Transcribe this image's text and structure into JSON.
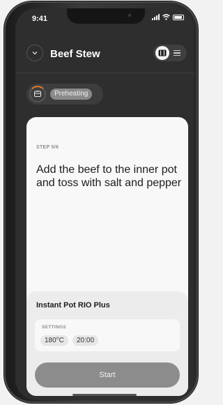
{
  "status_bar": {
    "time": "9:41"
  },
  "header": {
    "title": "Beef Stew",
    "back_icon": "chevron-down-icon",
    "view_toggle_icons": [
      "grid-view-icon",
      "list-view-icon"
    ]
  },
  "status": {
    "label": "Preheating",
    "icon": "appliance-icon",
    "accent": "#e07a2f"
  },
  "step": {
    "label": "STEP 5/6",
    "instruction": "Add the beef to the inner pot and toss with salt and pepper"
  },
  "device": {
    "name": "Instant Pot RIO Plus",
    "settings_label": "SETTINGS",
    "temperature": "180°C",
    "time": "20:00",
    "start_label": "Start"
  }
}
